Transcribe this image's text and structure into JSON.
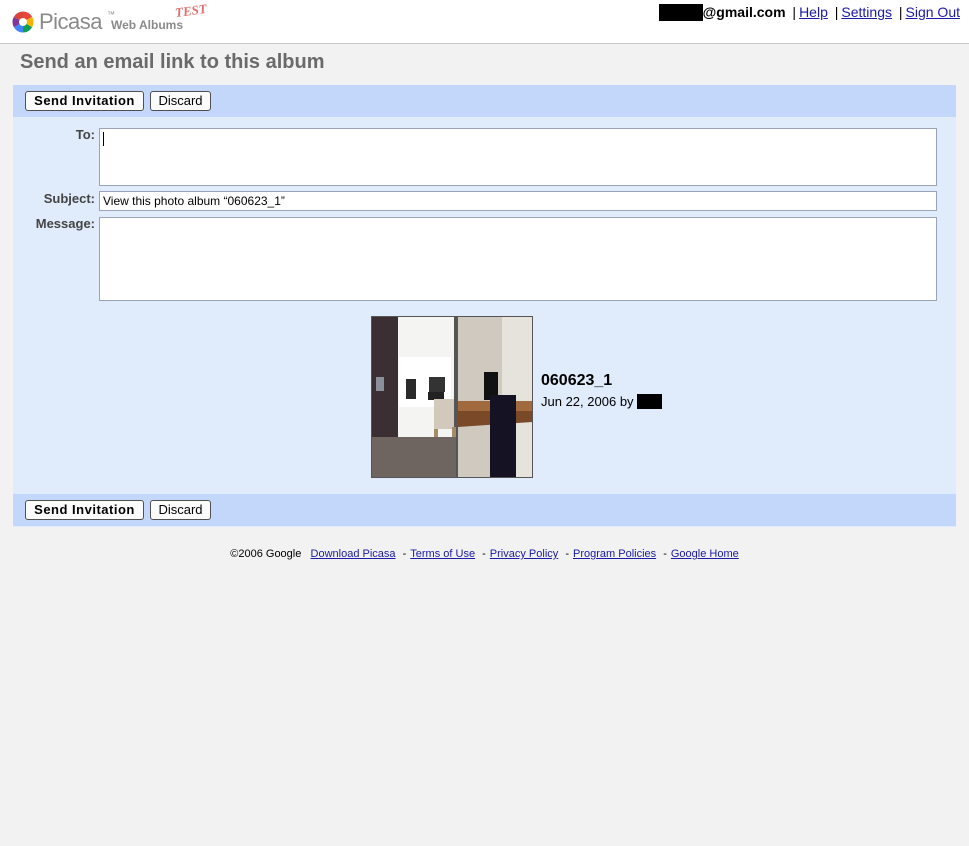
{
  "header": {
    "logo": {
      "brand": "Picasa",
      "trademark": "™",
      "product": "Web Albums",
      "badge": "TEST"
    },
    "user_email": "@gmail.com",
    "links": {
      "help": "Help",
      "settings": "Settings",
      "sign_out": "Sign Out"
    },
    "separator": "|"
  },
  "page_title": "Send an email link to this album",
  "form": {
    "send_label": "Send Invitation",
    "discard_label": "Discard",
    "to_label": "To:",
    "to_value": "",
    "subject_label": "Subject:",
    "subject_value": "View this photo album “060623_1”",
    "message_label": "Message:",
    "message_value": ""
  },
  "album": {
    "name": "060623_1",
    "date": "Jun 22, 2006",
    "by": "by"
  },
  "footer": {
    "copyright": "©2006 Google",
    "links": [
      "Download Picasa",
      "Terms of Use",
      "Privacy Policy",
      "Program Policies",
      "Google Home"
    ],
    "separator": "-"
  },
  "colors": {
    "toolbar": "#c3d7fb",
    "form_bg": "#e0ebfc",
    "link": "#1a1aa6",
    "title": "#6a6a6a"
  }
}
